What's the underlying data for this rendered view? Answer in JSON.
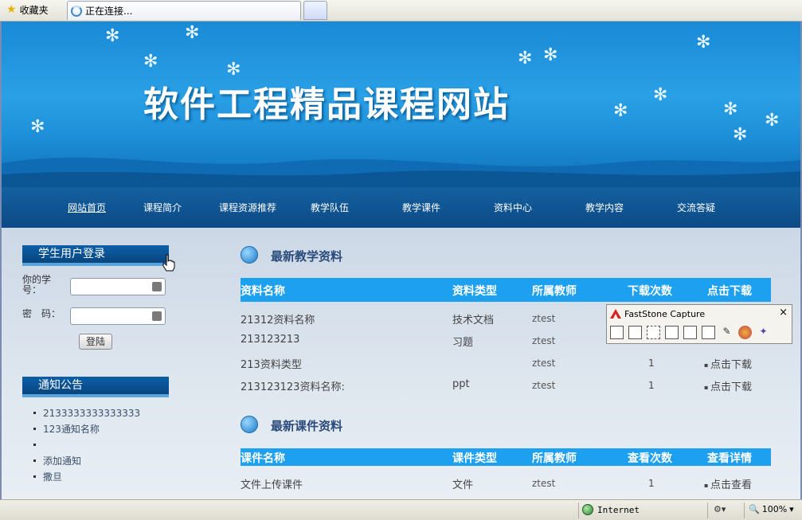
{
  "browser": {
    "favorites_label": "收藏夹",
    "tab_title": "正在连接...",
    "status_zone": "Internet",
    "zoom": "100%"
  },
  "site": {
    "title": "软件工程精品课程网站",
    "nav": [
      "网站首页",
      "课程简介",
      "课程资源推荐",
      "教学队伍",
      "教学课件",
      "资料中心",
      "教学内容",
      "交流答疑"
    ]
  },
  "login": {
    "heading": "学生用户登录",
    "student_label": "你的学号：",
    "password_label": "密　码：",
    "student_value": "",
    "password_value": "",
    "submit_label": "登陆"
  },
  "notice": {
    "heading": "通知公告",
    "items": [
      "2133333333333333",
      "123通知名称",
      "",
      "添加通知",
      "撒旦"
    ]
  },
  "materials": {
    "heading": "最新教学资料",
    "columns": [
      "资料名称",
      "资料类型",
      "所属教师",
      "下载次数",
      "点击下载"
    ],
    "rows": [
      {
        "name": "21312资料名称",
        "type": "技术文档",
        "teacher": "ztest",
        "count": "",
        "action": ""
      },
      {
        "name": "213123213",
        "type": "习题",
        "teacher": "ztest",
        "count": "",
        "action": ""
      },
      {
        "name": "213资料类型",
        "type": "",
        "teacher": "ztest",
        "count": "1",
        "action": "点击下载"
      },
      {
        "name": "213123123资料名称:",
        "type": "ppt",
        "teacher": "ztest",
        "count": "1",
        "action": "点击下载"
      }
    ]
  },
  "courseware": {
    "heading": "最新课件资料",
    "columns": [
      "课件名称",
      "课件类型",
      "所属教师",
      "查看次数",
      "查看详情"
    ],
    "rows": [
      {
        "name": "文件上传课件",
        "type": "文件",
        "teacher": "ztest",
        "count": "1",
        "action": "点击查看"
      }
    ]
  },
  "faststone": {
    "title": "FastStone Capture",
    "close": "×"
  },
  "colors": {
    "banner": "#1a8ad6",
    "nav": "#0c4a86",
    "table_header": "#1ea0f0"
  }
}
